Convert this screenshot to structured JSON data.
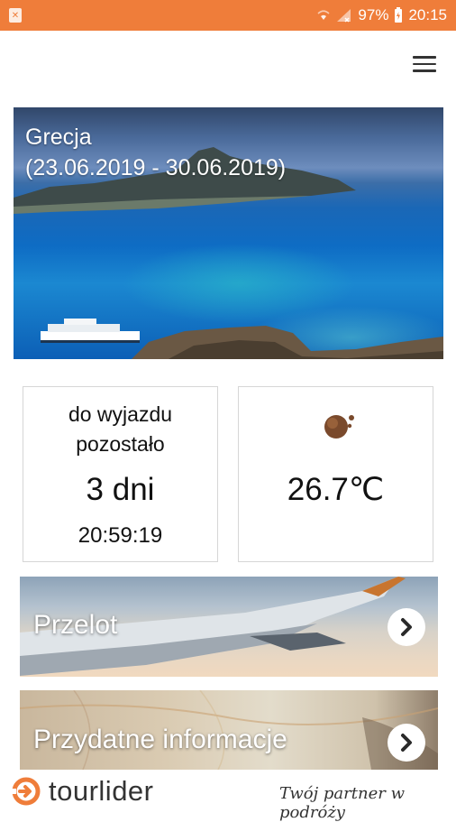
{
  "status_bar": {
    "battery": "97%",
    "time": "20:15"
  },
  "hero": {
    "destination": "Grecja",
    "dates": "(23.06.2019 - 30.06.2019)"
  },
  "countdown": {
    "label_line1": "do wyjazdu",
    "label_line2": "pozostało",
    "days": "3 dni",
    "time_left": "20:59:19"
  },
  "weather": {
    "icon": "partly-cloudy-sun-icon",
    "temperature": "26.7℃"
  },
  "banners": [
    {
      "label": "Przelot",
      "icon": "chevron-right-icon"
    },
    {
      "label": "Przydatne informacje",
      "icon": "chevron-right-icon"
    }
  ],
  "footer": {
    "logo_text": "tourlider",
    "tagline": "Twój partner w podróży"
  },
  "colors": {
    "accent": "#ef7d3a",
    "text": "#111111",
    "card_border": "#d6d6d6"
  }
}
